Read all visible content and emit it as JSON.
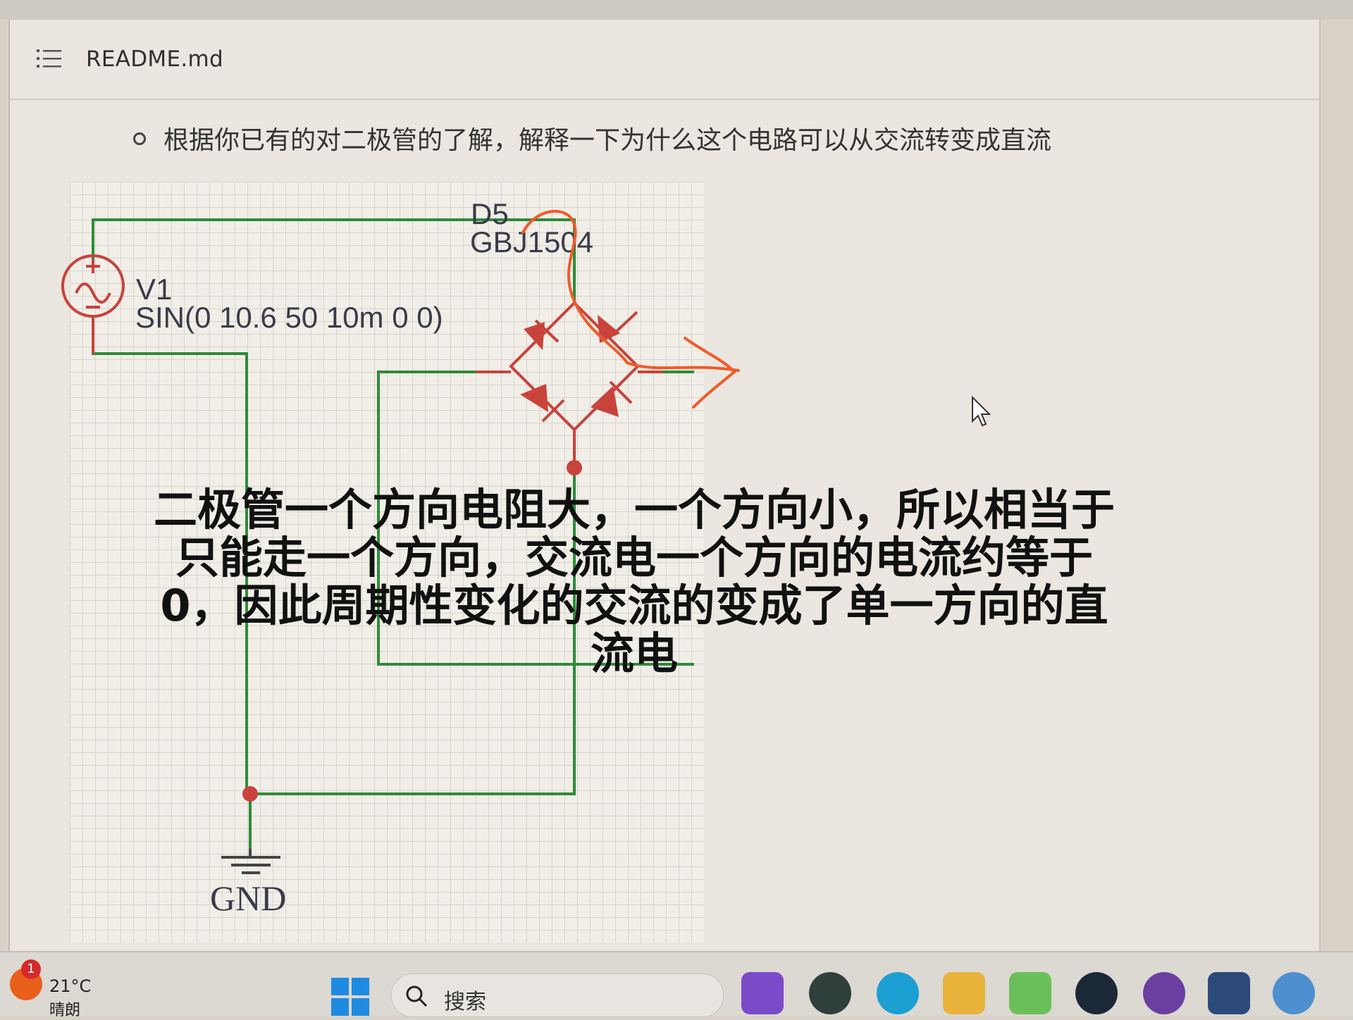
{
  "header": {
    "title": "README.md",
    "list_icon": "list-icon"
  },
  "content": {
    "question": "根据你已有的对二极管的了解，解释一下为什么这个电路可以从交流转变成直流"
  },
  "schematic": {
    "source_ref": "V1",
    "source_value": "SIN(0 10.6 50 10m 0 0)",
    "bridge_ref": "D5",
    "bridge_part": "GBJ1504",
    "ground_label": "GND",
    "colors": {
      "wire": "#2e8b3a",
      "component": "#c8433c",
      "annotation": "#f05a28"
    }
  },
  "annotation": {
    "line1": "二极管一个方向电阻大，一个方向小，所以相当于",
    "line2": "只能走一个方向，交流电一个方向的电流约等于",
    "line3": "0，因此周期性变化的交流的变成了单一方向的直",
    "line4": "流电"
  },
  "taskbar": {
    "weather_badge": "1",
    "weather_temp": "21°C",
    "weather_cond": "晴朗",
    "search_label": "搜索",
    "apps": [
      "visual-studio-icon",
      "obs-icon",
      "edge-icon",
      "file-explorer-icon",
      "todo-icon",
      "steam-icon",
      "github-icon",
      "store-icon",
      "settings-icon"
    ]
  }
}
